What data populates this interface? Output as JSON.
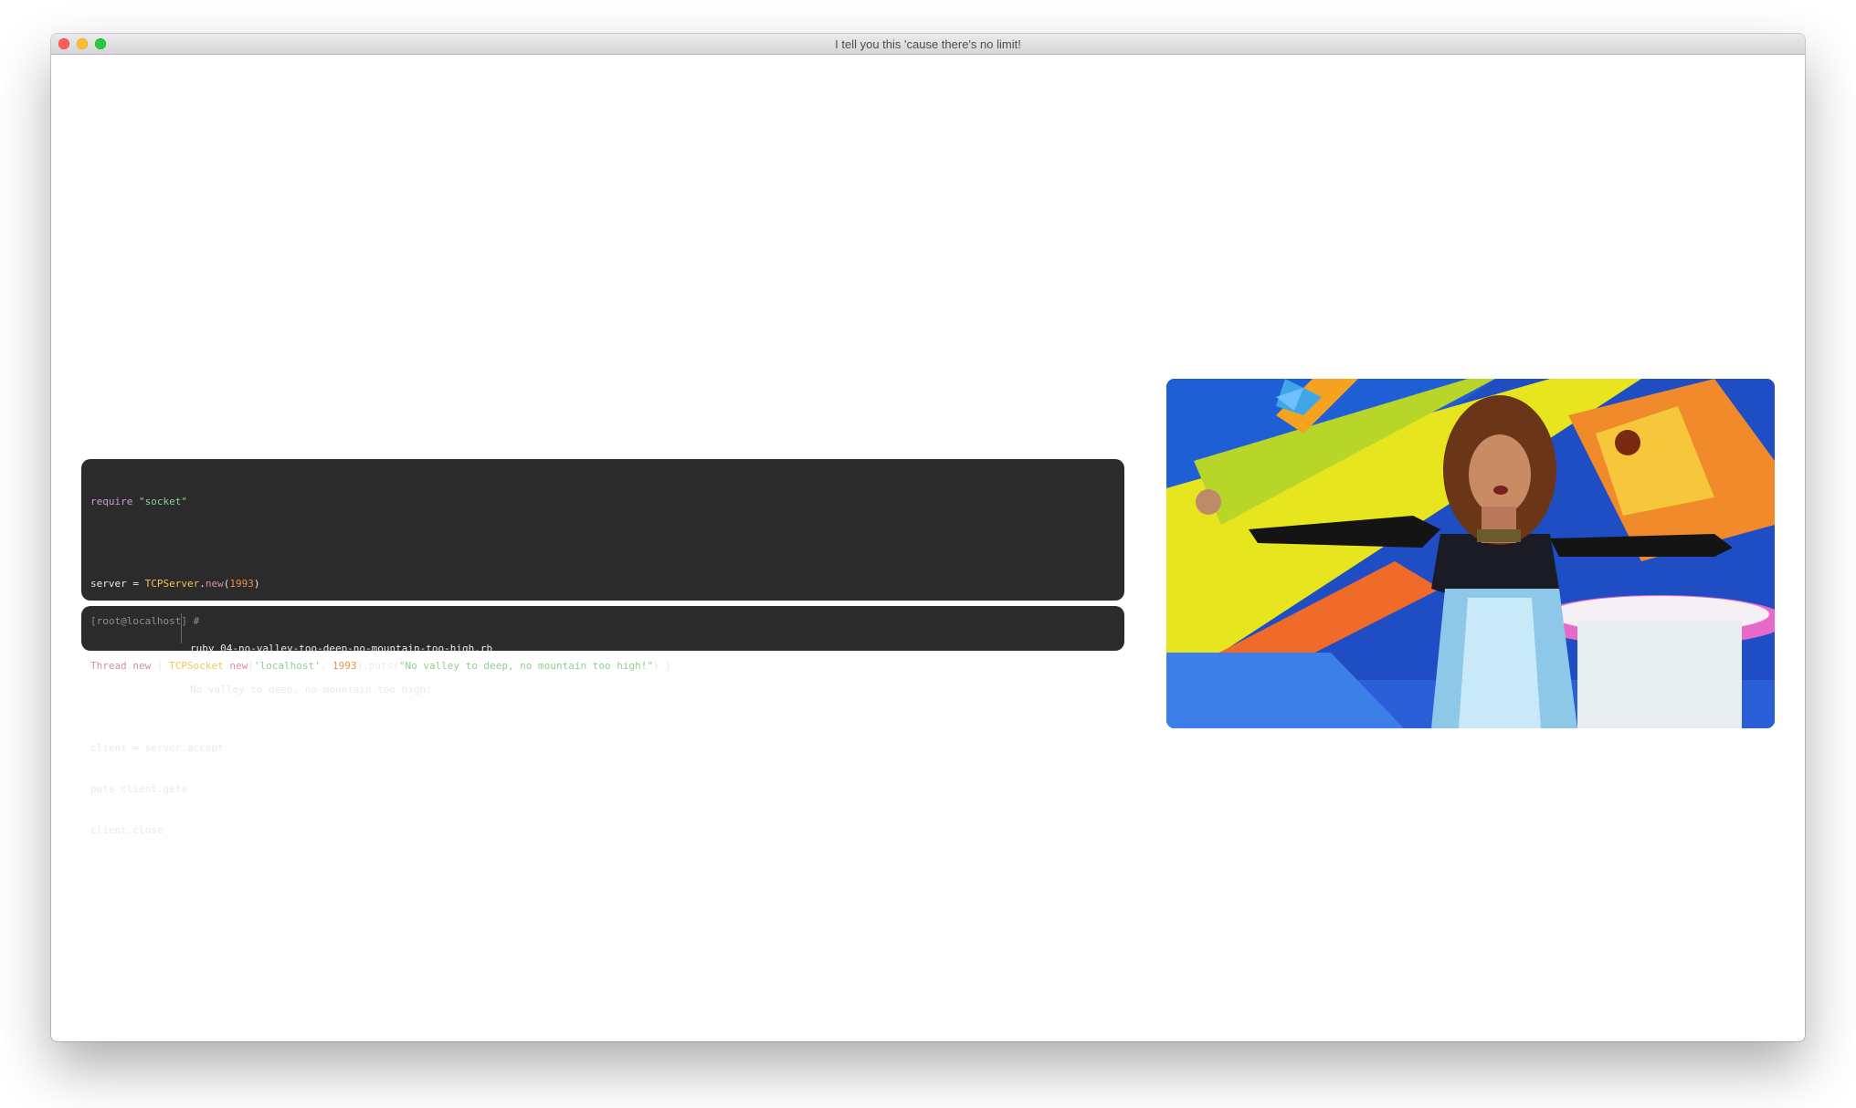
{
  "window": {
    "title": "I tell you this 'cause there's no limit!"
  },
  "code": {
    "line1": {
      "kw": "require",
      "str": "\"socket\""
    },
    "line2": {
      "pre": "server = ",
      "cls": "TCPServer",
      "dot": ".",
      "mth": "new",
      "open": "(",
      "num": "1993",
      "close": ")"
    },
    "line3": {
      "cls1": "Thread",
      "dot1": ".",
      "mth1": "new",
      "brace_open": " { ",
      "cls2": "TCPSocket",
      "dot2": ".",
      "mth2": "new",
      "paren_open": "(",
      "str1": "'localhost'",
      "comma": ", ",
      "num": "1993",
      "rest": ").puts(",
      "str2": "\"No valley to deep, no mountain too high!\"",
      "tail": ") }"
    },
    "line4": "client = server.accept",
    "line5": "puts client.gets",
    "line6": "client.close"
  },
  "terminal": {
    "prompt": "[root@localhost] #",
    "command": "ruby 04-no-valley-too-deep-no-mountain-too-high.rb",
    "output": "No valley to deep, no mountain too high!"
  },
  "video": {
    "description_icon": "music-video-frame"
  },
  "colors": {
    "panel_bg": "#2b2b2b",
    "keyword": "#cc9bd6",
    "string": "#8fd08f",
    "class": "#f6c452",
    "number": "#f08d49"
  }
}
